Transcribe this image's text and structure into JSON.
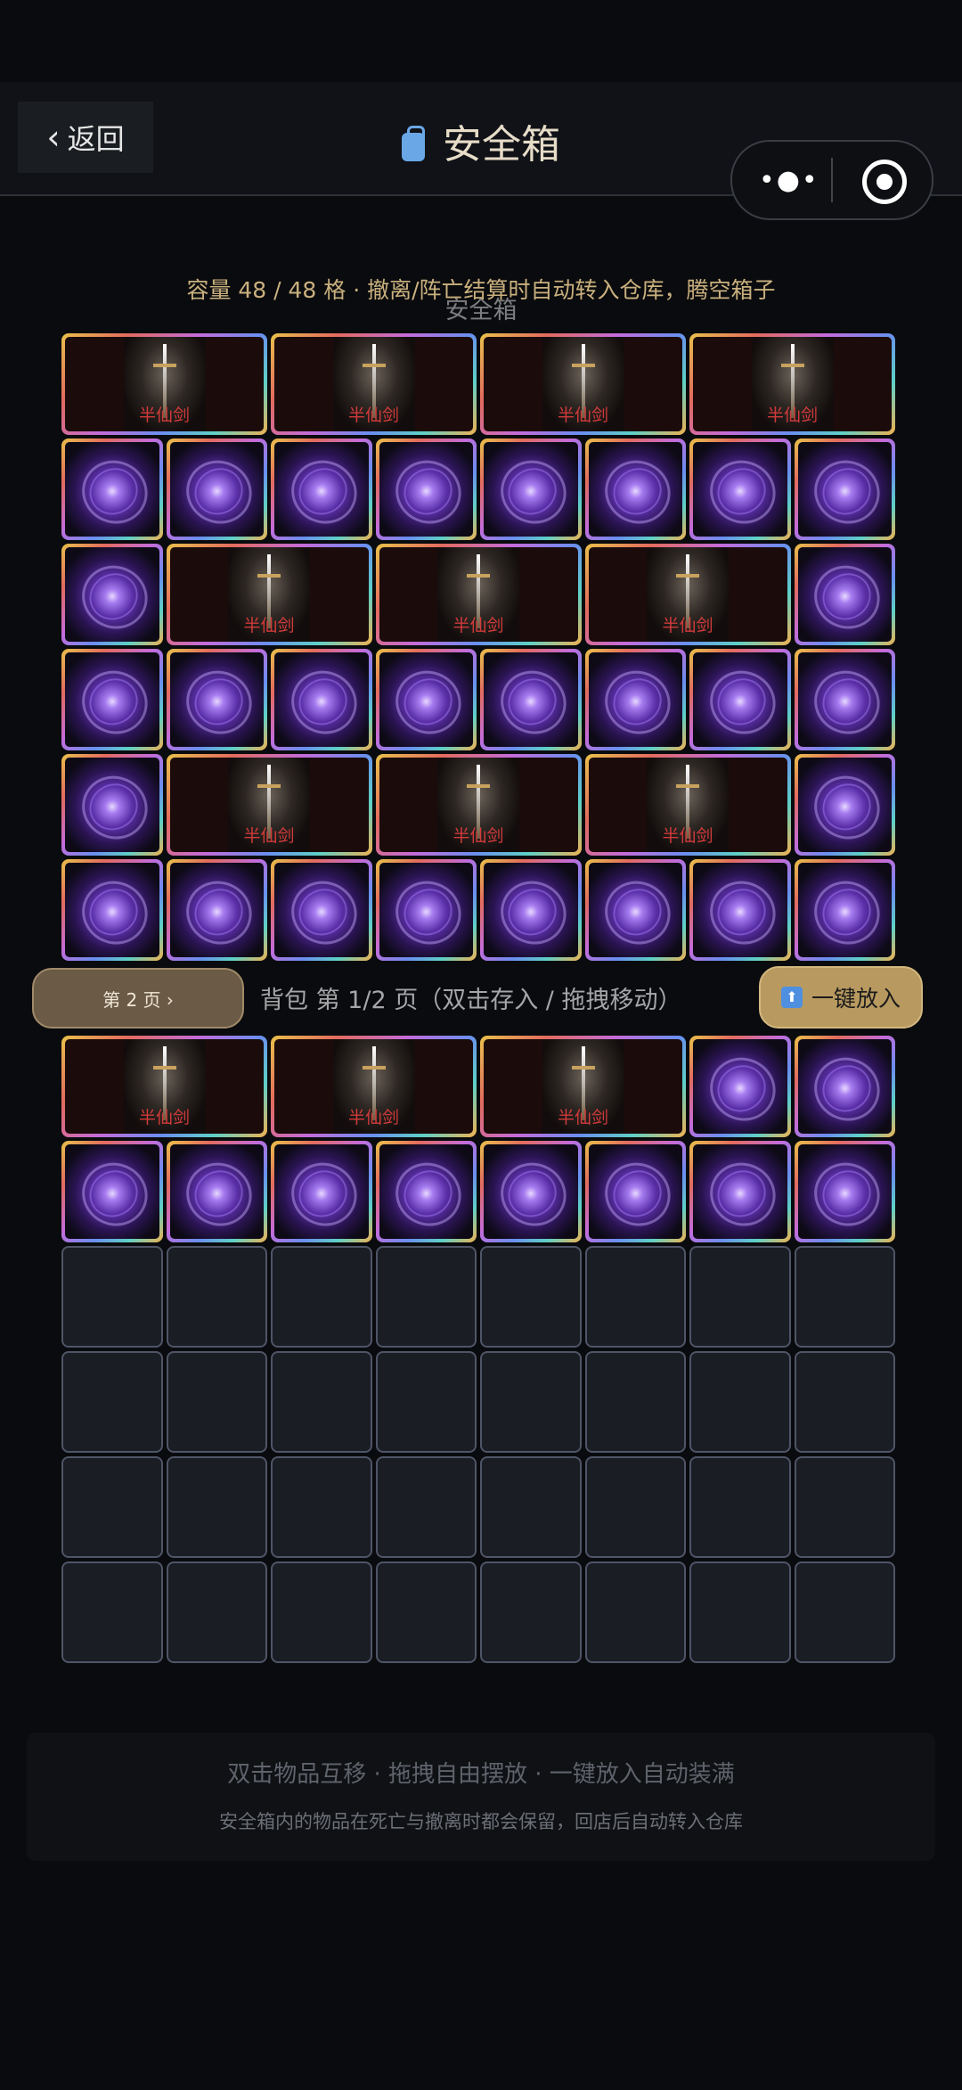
{
  "header": {
    "back_label": "返回",
    "title": "安全箱"
  },
  "safe_box": {
    "capacity_text": "容量 48 / 48 格 · 撤离/阵亡结算时自动转入仓库，腾空箱子",
    "ghost_title": "安全箱",
    "rows": [
      [
        "sword2",
        "sword2",
        "sword2",
        "sword2"
      ],
      [
        "orb",
        "orb",
        "orb",
        "orb",
        "orb",
        "orb",
        "orb",
        "orb"
      ],
      [
        "orb",
        "sword2",
        "sword2",
        "sword2",
        "orb"
      ],
      [
        "orb",
        "orb",
        "orb",
        "orb",
        "orb",
        "orb",
        "orb",
        "orb"
      ],
      [
        "orb",
        "sword2",
        "sword2",
        "sword2",
        "orb"
      ],
      [
        "orb",
        "orb",
        "orb",
        "orb",
        "orb",
        "orb",
        "orb",
        "orb"
      ]
    ]
  },
  "item_names": {
    "sword": "半仙剑"
  },
  "controls": {
    "page_button": "第 2 页 ›",
    "bag_label": "背包 第 1/2 页（双击存入 / 拖拽移动）",
    "auto_fill_button": "一键放入"
  },
  "backpack": {
    "rows": [
      [
        "sword2",
        "sword2",
        "sword2",
        "orb",
        "orb"
      ],
      [
        "orb",
        "orb",
        "orb",
        "orb",
        "orb",
        "orb",
        "orb",
        "orb"
      ],
      [
        "empty",
        "empty",
        "empty",
        "empty",
        "empty",
        "empty",
        "empty",
        "empty"
      ],
      [
        "empty",
        "empty",
        "empty",
        "empty",
        "empty",
        "empty",
        "empty",
        "empty"
      ],
      [
        "empty",
        "empty",
        "empty",
        "empty",
        "empty",
        "empty",
        "empty",
        "empty"
      ],
      [
        "empty",
        "empty",
        "empty",
        "empty",
        "empty",
        "empty",
        "empty",
        "empty"
      ]
    ]
  },
  "footer": {
    "line1": "双击物品互移 · 拖拽自由摆放 · 一键放入自动装满",
    "line2": "安全箱内的物品在死亡与撤离时都会保留，回店后自动转入仓库"
  }
}
